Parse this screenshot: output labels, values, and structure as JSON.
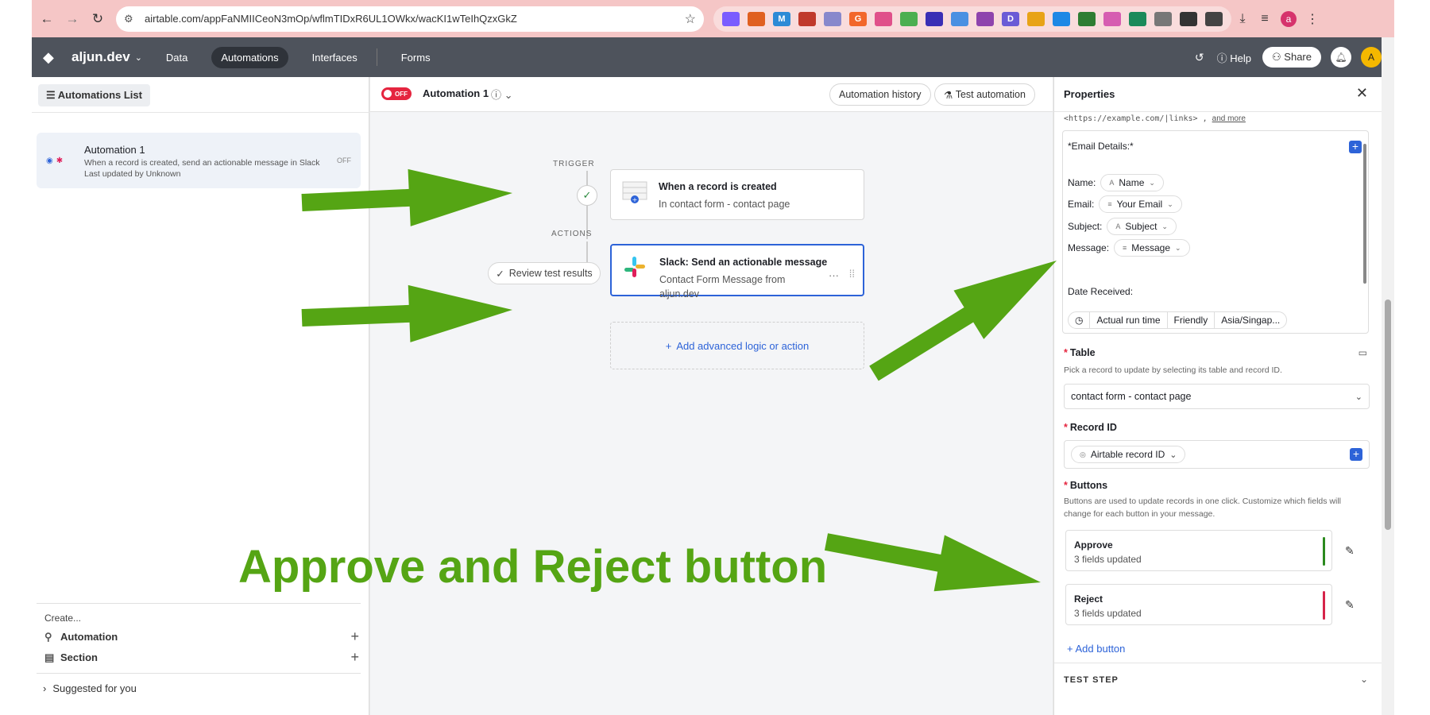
{
  "browser": {
    "url": "airtable.com/appFaNMIICeoN3mOp/wflmTIDxR6UL1OWkx/wacKI1wTeIhQzxGkZ",
    "profile_initial": "a",
    "extensions": [
      {
        "icon": "",
        "color": "#7a5cff"
      },
      {
        "icon": "",
        "color": "#e06020"
      },
      {
        "icon": "M",
        "color": "#2d8bd6"
      },
      {
        "icon": "",
        "color": "#c0392b"
      },
      {
        "icon": "",
        "color": "#8888cc"
      },
      {
        "icon": "G",
        "color": "#f2672b"
      },
      {
        "icon": "",
        "color": "#e0508a"
      },
      {
        "icon": "",
        "color": "#4caf50"
      },
      {
        "icon": "",
        "color": "#3a2fb5"
      },
      {
        "icon": "",
        "color": "#4a90e2"
      },
      {
        "icon": "",
        "color": "#8e44ad"
      },
      {
        "icon": "D",
        "color": "#6b5bd6"
      },
      {
        "icon": "",
        "color": "#e8a317"
      },
      {
        "icon": "",
        "color": "#1e88e5"
      },
      {
        "icon": "",
        "color": "#2e7d32"
      },
      {
        "icon": "",
        "color": "#d65db1"
      },
      {
        "icon": "",
        "color": "#1b8a5a"
      },
      {
        "icon": "",
        "color": "#777777"
      },
      {
        "icon": "",
        "color": "#333333"
      },
      {
        "icon": "",
        "color": "#444444"
      }
    ]
  },
  "appbar": {
    "base_name": "aljun.dev",
    "tabs": [
      "Data",
      "Automations",
      "Interfaces",
      "Forms"
    ],
    "active_tab": "Automations",
    "help": "Help",
    "share": "Share",
    "avatar_initial": "A"
  },
  "left": {
    "list_button": "Automations List",
    "automation": {
      "title": "Automation 1",
      "desc": "When a record is created, send an actionable message in Slack",
      "updated": "Last updated by Unknown",
      "status": "OFF"
    },
    "create_label": "Create...",
    "create_items": [
      "Automation",
      "Section"
    ],
    "suggested": "Suggested for you"
  },
  "canvas": {
    "toggle": "OFF",
    "name": "Automation 1",
    "history": "Automation history",
    "test": "Test automation",
    "trigger_label": "TRIGGER",
    "actions_label": "ACTIONS",
    "trigger": {
      "title": "When a record is created",
      "sub": "In contact form - contact page"
    },
    "action": {
      "title": "Slack: Send an actionable message",
      "sub": "Contact Form Message from aljun.dev"
    },
    "review": "Review test results",
    "add_logic": "Add advanced logic or action"
  },
  "props": {
    "title": "Properties",
    "link_text": "<https://example.com/|links>",
    "link_more": "and more",
    "email_heading": "*Email Details:*",
    "fields": [
      {
        "label": "Name:",
        "value": "Name"
      },
      {
        "label": "Email:",
        "value": "Your Email"
      },
      {
        "label": "Subject:",
        "value": "Subject"
      },
      {
        "label": "Message:",
        "value": "Message"
      }
    ],
    "date_label": "Date Received:",
    "run_time": [
      "Actual run time",
      "Friendly",
      "Asia/Singap..."
    ],
    "table_title": "Table",
    "table_help": "Pick a record to update by selecting its table and record ID.",
    "table_value": "contact form - contact page",
    "record_title": "Record ID",
    "record_value": "Airtable record ID",
    "buttons_title": "Buttons",
    "buttons_help": "Buttons are used to update records in one click. Customize which fields will change for each button in your message.",
    "buttons": [
      {
        "name": "Approve",
        "sub": "3 fields updated",
        "color": "#2b8a1e"
      },
      {
        "name": "Reject",
        "sub": "3 fields updated",
        "color": "#d6244a"
      }
    ],
    "add_button": "Add button",
    "test_step": "TEST STEP"
  },
  "annotation": {
    "text": "Approve and Reject button",
    "color": "#55a514"
  }
}
